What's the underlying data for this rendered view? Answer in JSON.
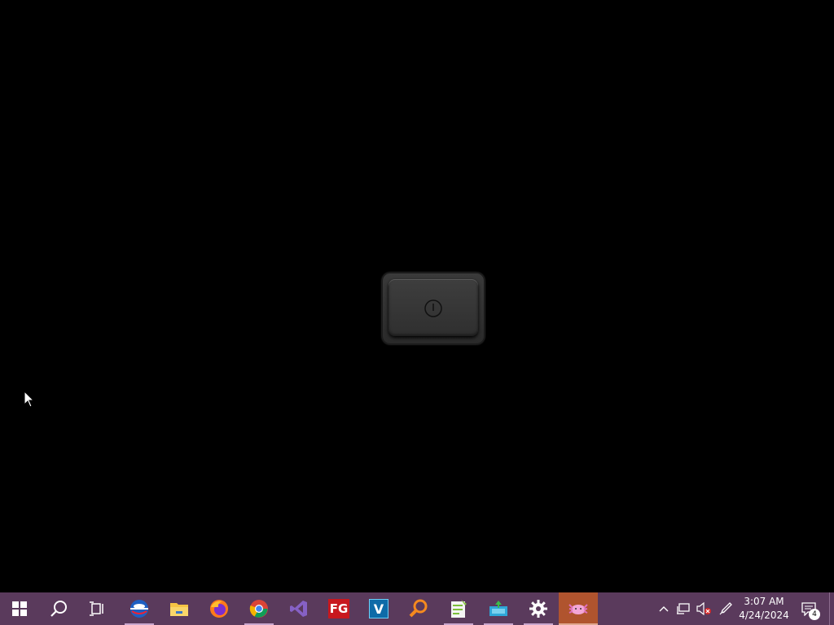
{
  "taskbar": {
    "clock": {
      "time": "3:07 AM",
      "date": "4/24/2024"
    },
    "notifications": {
      "count": "4"
    },
    "apps": [
      {
        "name": "Start"
      },
      {
        "name": "Search"
      },
      {
        "name": "Task View"
      },
      {
        "name": "Edge/IE"
      },
      {
        "name": "File Explorer"
      },
      {
        "name": "Firefox"
      },
      {
        "name": "Chrome"
      },
      {
        "name": "Visual Studio"
      },
      {
        "name": "FG"
      },
      {
        "name": "V"
      },
      {
        "name": "Search Tool"
      },
      {
        "name": "Notepad++"
      },
      {
        "name": "Installer"
      },
      {
        "name": "Settings"
      },
      {
        "name": "Active App"
      }
    ],
    "fg_label": "FG",
    "v_label": "V"
  },
  "colors": {
    "taskbar": "#5a3a5c",
    "active": "#b0542e",
    "desktop": "#000000"
  }
}
